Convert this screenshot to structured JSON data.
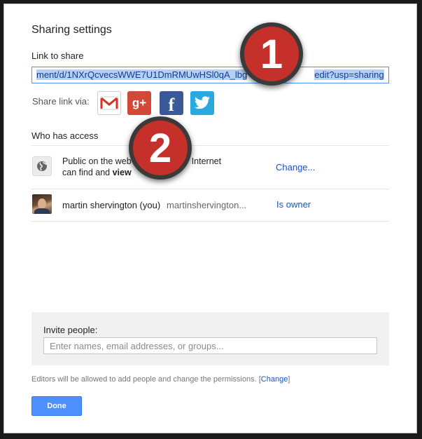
{
  "dialog": {
    "title": "Sharing settings",
    "link_section": {
      "label": "Link to share",
      "value": "ment/d/1NXrQcvecsWWE7U1DmRMUwHSl0qA_lbg",
      "value_tail": "edit?usp=sharing"
    },
    "share_via": {
      "label": "Share link via:",
      "services": [
        "gmail-icon",
        "google-plus-icon",
        "facebook-icon",
        "twitter-icon"
      ],
      "gplus_glyph": "g+",
      "fb_glyph": "f"
    },
    "access": {
      "label": "Who has access",
      "public": {
        "line1_a": "Public on the web",
        "line1_b": "Internet",
        "line2_a": "can find and",
        "line2_b": "view",
        "action": "Change..."
      },
      "owner": {
        "name": "martin shervington (you)",
        "email": "martinshervington...",
        "role": "Is owner"
      }
    },
    "invite": {
      "label": "Invite people:",
      "placeholder": "Enter names, email addresses, or groups..."
    },
    "editors_note": {
      "text": "Editors will be allowed to add people and change the permissions.",
      "open": "[",
      "link": "Change",
      "close": "]"
    },
    "done_label": "Done"
  },
  "annotations": {
    "badge_1": "1",
    "badge_2": "2"
  },
  "colors": {
    "accent_blue": "#4d90fe",
    "link_blue": "#1155cc",
    "badge_red": "#c6302a",
    "gplus_red": "#d34836",
    "facebook_blue": "#3b5998",
    "twitter_blue": "#2aa9e0"
  }
}
